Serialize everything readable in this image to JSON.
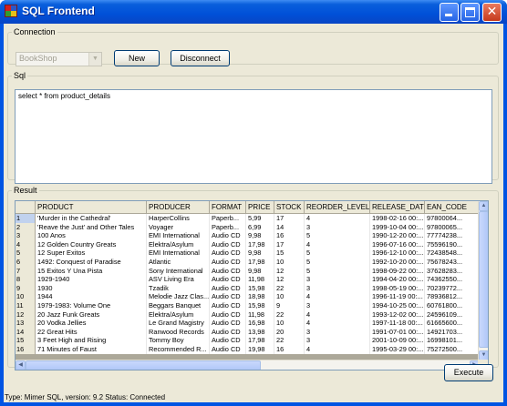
{
  "window": {
    "title": "SQL Frontend",
    "minimize_icon": "minimize-icon",
    "maximize_icon": "maximize-icon",
    "close_glyph": "✕"
  },
  "connection": {
    "group_label": "Connection",
    "database_select_value": "BookShop",
    "new_label": "New",
    "disconnect_label": "Disconnect"
  },
  "sql": {
    "group_label": "Sql",
    "query": "select * from product_details"
  },
  "result": {
    "group_label": "Result",
    "columns": [
      "PRODUCT",
      "PRODUCER",
      "FORMAT",
      "PRICE",
      "STOCK",
      "REORDER_LEVEL",
      "RELEASE_DATE",
      "EAN_CODE"
    ],
    "rows": [
      [
        "1",
        "'Murder in the Cathedral'",
        "HarperCollins",
        "Paperb...",
        "5,99",
        "17",
        "4",
        "1998-02-16 00:...",
        "97800064..."
      ],
      [
        "2",
        "'Reave the Just' and Other Tales",
        "Voyager",
        "Paperb...",
        "6,99",
        "14",
        "3",
        "1999-10-04 00:...",
        "97800065..."
      ],
      [
        "3",
        "100 Anos",
        "EMI International",
        "Audio CD",
        "9,98",
        "16",
        "5",
        "1990-12-20 00:...",
        "77774238..."
      ],
      [
        "4",
        "12 Golden Country Greats",
        "Elektra/Asylum",
        "Audio CD",
        "17,98",
        "17",
        "4",
        "1996-07-16 00:...",
        "75596190..."
      ],
      [
        "5",
        "12 Super Exitos",
        "EMI International",
        "Audio CD",
        "9,98",
        "15",
        "5",
        "1996-12-10 00:...",
        "72438548..."
      ],
      [
        "6",
        "1492: Conquest of Paradise",
        "Atlantic",
        "Audio CD",
        "17,98",
        "10",
        "5",
        "1992-10-20 00:...",
        "75678243..."
      ],
      [
        "7",
        "15 Exitos Y Una Pista",
        "Sony International",
        "Audio CD",
        "9,98",
        "12",
        "5",
        "1998-09-22 00:...",
        "37628283..."
      ],
      [
        "8",
        "1929-1940",
        "ASV Living Era",
        "Audio CD",
        "11,98",
        "12",
        "3",
        "1994-04-20 00:...",
        "74362550..."
      ],
      [
        "9",
        "1930",
        "Tzadik",
        "Audio CD",
        "15,98",
        "22",
        "3",
        "1998-05-19 00:...",
        "70239772..."
      ],
      [
        "10",
        "1944",
        "Melodie Jazz Clas...",
        "Audio CD",
        "18,98",
        "10",
        "4",
        "1996-11-19 00:...",
        "78936812..."
      ],
      [
        "11",
        "1979-1983: Volume One",
        "Beggars Banquet",
        "Audio CD",
        "15,98",
        "9",
        "3",
        "1994-10-25 00:...",
        "60761800..."
      ],
      [
        "12",
        "20 Jazz Funk Greats",
        "Elektra/Asylum",
        "Audio CD",
        "11,98",
        "22",
        "4",
        "1993-12-02 00:...",
        "24596109..."
      ],
      [
        "13",
        "20 Vodka Jellies",
        "Le Grand Magistry",
        "Audio CD",
        "16,98",
        "10",
        "4",
        "1997-11-18 00:...",
        "61665600..."
      ],
      [
        "14",
        "22 Great Hits",
        "Ranwood Records",
        "Audio CD",
        "13,98",
        "20",
        "3",
        "1991-07-01 00:...",
        "14921703..."
      ],
      [
        "15",
        "3 Feet High and Rising",
        "Tommy Boy",
        "Audio CD",
        "17,98",
        "22",
        "3",
        "2001-10-09 00:...",
        "16998101..."
      ],
      [
        "16",
        "71 Minutes of Faust",
        "Recommended R...",
        "Audio CD",
        "19,98",
        "16",
        "4",
        "1995-03-29 00:...",
        "75272500..."
      ]
    ]
  },
  "execute_label": "Execute",
  "status": "Type: Mimer SQL, version: 9.2 Status: Connected",
  "colors": {
    "titlebar": "#0054e3",
    "client": "#ece9d8",
    "border": "#7f9db9"
  }
}
